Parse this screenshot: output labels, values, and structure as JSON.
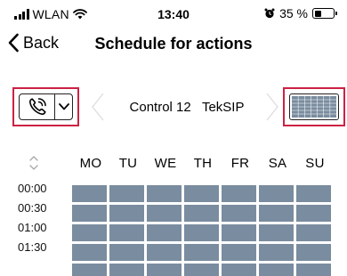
{
  "status_bar": {
    "carrier": "WLAN",
    "time": "13:40",
    "battery_text": "35 %",
    "battery_level": 0.35
  },
  "nav": {
    "back_label": "Back",
    "title": "Schedule for actions"
  },
  "control": {
    "device_name": "Control 12   TekSIP",
    "device_icon": "phone-icon",
    "view_icon": "grid-view-icon"
  },
  "schedule": {
    "days": [
      "MO",
      "TU",
      "WE",
      "TH",
      "FR",
      "SA",
      "SU"
    ],
    "times": [
      "00:00",
      "00:30",
      "01:00",
      "01:30"
    ],
    "cell_color": "#7a8c9f"
  },
  "colors": {
    "highlight": "#cc2244",
    "divider": "#dddddd"
  }
}
